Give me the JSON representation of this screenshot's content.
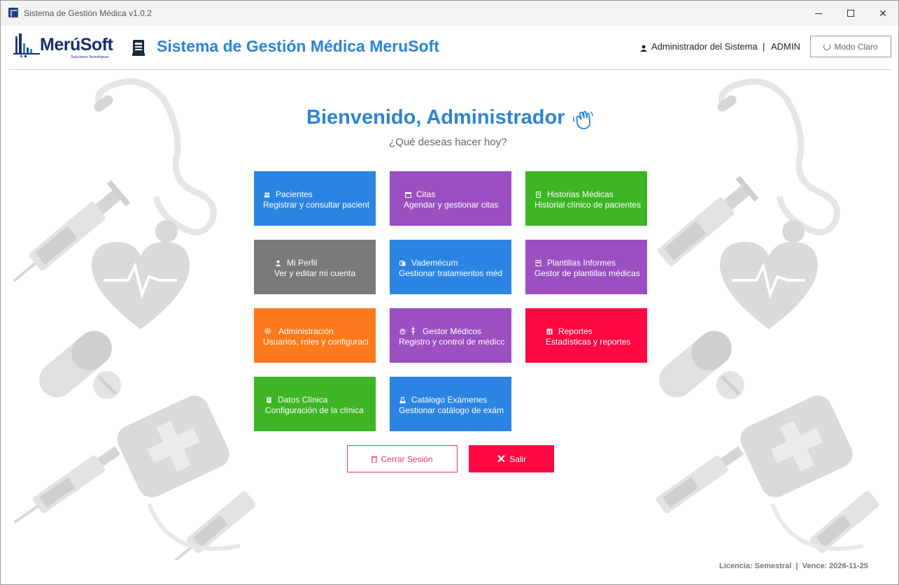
{
  "window": {
    "title": "Sistema de Gestión Médica v1.0.2"
  },
  "header": {
    "logo_text": "MerúSoft",
    "logo_subtitle": "Soluciones Tecnológicas",
    "app_title": "Sistema de Gestión Médica MeruSoft",
    "user_name": "Administrador del Sistema",
    "separator": "|",
    "user_role": "ADMIN",
    "mode_button": "Modo Claro"
  },
  "welcome": {
    "title": "Bienvenido, Administrador",
    "subtitle": "¿Qué deseas hacer hoy?"
  },
  "tiles": [
    {
      "title": "Pacientes",
      "desc": "Registrar y consultar pacient",
      "color": "#2b84e2",
      "icon": "users-icon"
    },
    {
      "title": "Citas",
      "desc": "Agendar y gestionar citas",
      "color": "#9b4fc1",
      "icon": "calendar-icon"
    },
    {
      "title": "Historias Médicas",
      "desc": "Historial clínico de pacientes",
      "color": "#3db524",
      "icon": "document-icon"
    },
    {
      "title": "Mi Perfil",
      "desc": "Ver y editar mi cuenta",
      "color": "#7a7a7a",
      "icon": "user-icon"
    },
    {
      "title": "Vademécum",
      "desc": "Gestionar tratamientos méd",
      "color": "#2b84e2",
      "icon": "book-icon"
    },
    {
      "title": "Plantillas Informes",
      "desc": "Gestor de plantillas médicas",
      "color": "#9b4fc1",
      "icon": "template-icon"
    },
    {
      "title": "Administración",
      "desc": "Usuarios, roles y configuraci",
      "color": "#fd7a1c",
      "icon": "gear-icon"
    },
    {
      "title": "Gestor Médicos",
      "desc": "Registro y control de médicc",
      "color": "#9b4fc1",
      "icon": "doctor-icon"
    },
    {
      "title": "Reportes",
      "desc": "Estadísticas y reportes",
      "color": "#fe0843",
      "icon": "chart-icon"
    },
    {
      "title": "Datos Clínica",
      "desc": "Configuración de la clínica",
      "color": "#3db524",
      "icon": "clinic-icon"
    },
    {
      "title": "Catálogo Exámenes",
      "desc": "Gestionar catálogo de exám",
      "color": "#2b84e2",
      "icon": "flask-icon"
    }
  ],
  "actions": {
    "logout": "Cerrar Sesión",
    "exit": "Salir"
  },
  "footer": {
    "license": "Licencia: Semestral  |  Vence: 2026-11-25"
  }
}
